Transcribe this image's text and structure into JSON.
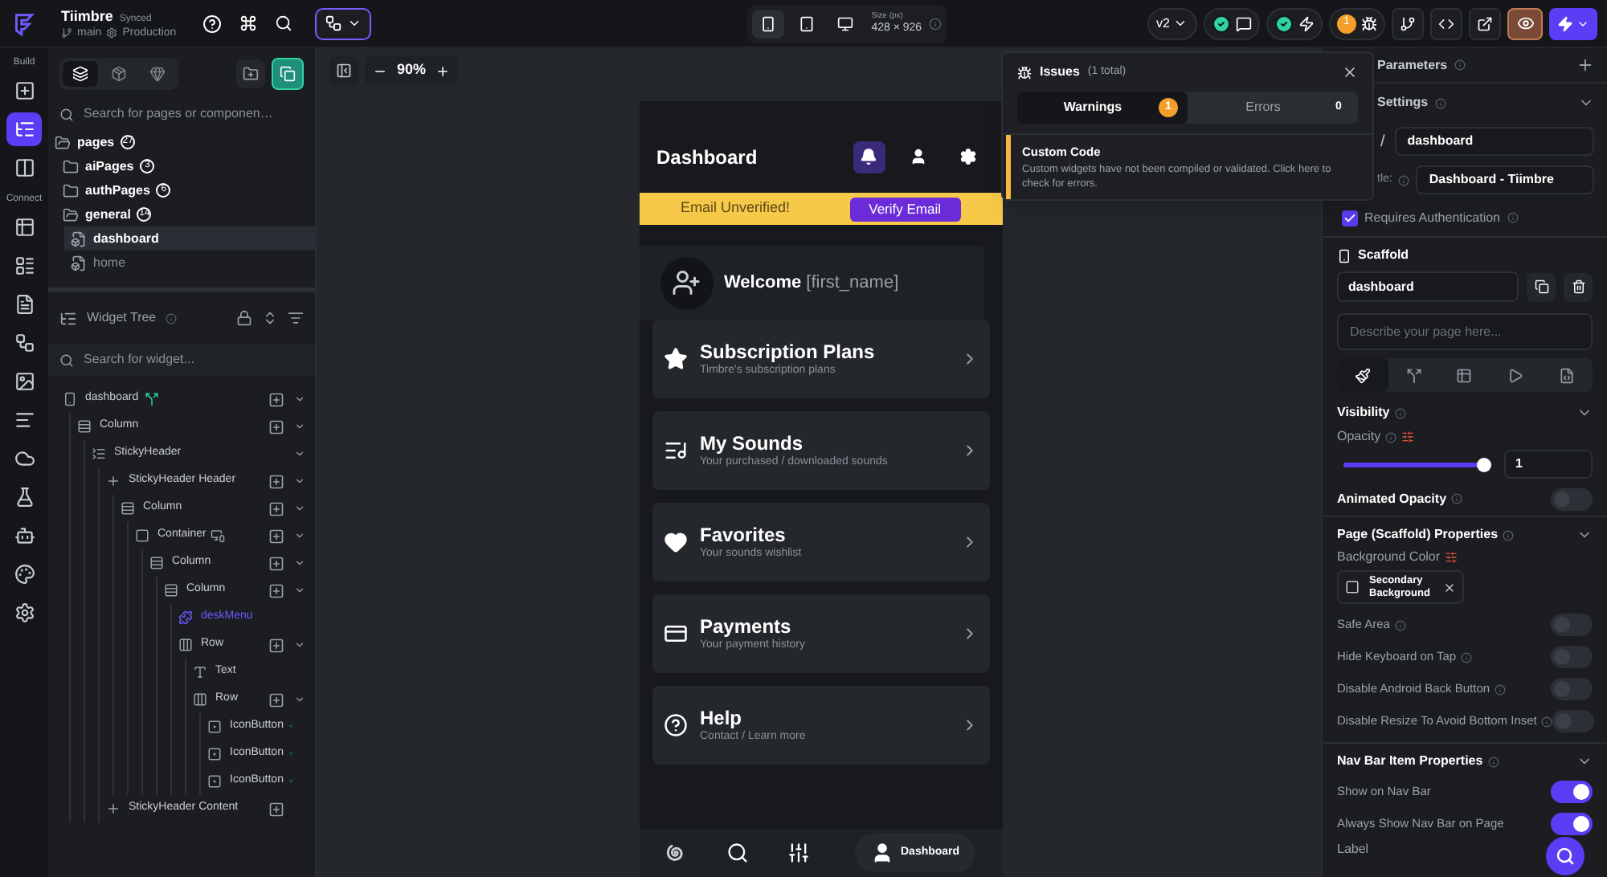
{
  "topbar": {
    "project": "Tiimbre",
    "sync_status": "Synced",
    "branch": "main",
    "environment": "Production",
    "devices": [
      {
        "kind": "phone",
        "selected": true
      },
      {
        "kind": "tablet",
        "selected": false
      },
      {
        "kind": "desktop",
        "selected": false
      }
    ],
    "size_label": "Size (px)",
    "size": "428 × 926",
    "version": "v2",
    "warning_count": "1"
  },
  "rail": [
    {
      "label": "Build",
      "items": [
        {
          "kind": "add-widget",
          "selected": false
        },
        {
          "kind": "tree",
          "selected": true
        },
        {
          "kind": "storyboard",
          "selected": false
        }
      ]
    },
    {
      "label": "Connect",
      "items": [
        {
          "kind": "database",
          "selected": false
        },
        {
          "kind": "schema",
          "selected": false
        },
        {
          "kind": "file",
          "selected": false
        },
        {
          "kind": "nodes",
          "selected": false
        },
        {
          "kind": "image",
          "selected": false
        },
        {
          "kind": "list",
          "selected": false
        },
        {
          "kind": "cloud",
          "selected": false
        },
        {
          "kind": "test",
          "selected": false
        },
        {
          "kind": "robot",
          "selected": false
        },
        {
          "kind": "theme",
          "selected": false
        },
        {
          "kind": "settings",
          "selected": false
        }
      ]
    }
  ],
  "pages_panel": {
    "tabs": [
      {
        "kind": "pages",
        "selected": true
      },
      {
        "kind": "components",
        "selected": false
      },
      {
        "kind": "library",
        "selected": false
      }
    ],
    "search_placeholder": "Search for pages or componen…",
    "tree": [
      {
        "kind": "folder",
        "name": "pages",
        "count": "27",
        "expanded": true,
        "children": [
          {
            "kind": "folder",
            "name": "aiPages",
            "count": "3",
            "expanded": false
          },
          {
            "kind": "folder",
            "name": "authPages",
            "count": "6",
            "expanded": false
          },
          {
            "kind": "folder",
            "name": "general",
            "count": "14",
            "expanded": true,
            "children": [
              {
                "kind": "page",
                "name": "dashboard",
                "selected": true
              },
              {
                "kind": "page",
                "name": "home",
                "selected": false
              }
            ]
          }
        ]
      }
    ]
  },
  "widget_tree": {
    "title": "Widget Tree",
    "search_placeholder": "Search for widget...",
    "nodes": [
      {
        "kind": "page",
        "name": "dashboard",
        "has_action": true,
        "can_add": true,
        "children": [
          {
            "kind": "column",
            "name": "Column",
            "can_add": true,
            "children": [
              {
                "kind": "sticky",
                "name": "StickyHeader",
                "can_add": false,
                "children": [
                  {
                    "kind": "plus",
                    "name": "StickyHeader Header",
                    "can_add": true,
                    "children": [
                      {
                        "kind": "column",
                        "name": "Column",
                        "can_add": true,
                        "children": [
                          {
                            "kind": "container",
                            "name": "Container",
                            "responsive": true,
                            "can_add": true,
                            "children": [
                              {
                                "kind": "column",
                                "name": "Column",
                                "can_add": true,
                                "children": [
                                  {
                                    "kind": "column",
                                    "name": "Column",
                                    "can_add": true,
                                    "children": [
                                      {
                                        "kind": "custom",
                                        "name": "deskMenu",
                                        "can_add": false
                                      },
                                      {
                                        "kind": "row",
                                        "name": "Row",
                                        "can_add": true,
                                        "children": [
                                          {
                                            "kind": "text",
                                            "name": "Text",
                                            "can_add": false
                                          },
                                          {
                                            "kind": "row",
                                            "name": "Row",
                                            "can_add": true,
                                            "children": [
                                              {
                                                "kind": "iconbutton",
                                                "name": "IconButton",
                                                "has_action": true,
                                                "can_add": false
                                              },
                                              {
                                                "kind": "iconbutton",
                                                "name": "IconButton",
                                                "has_action": true,
                                                "can_add": false
                                              },
                                              {
                                                "kind": "iconbutton",
                                                "name": "IconButton",
                                                "has_action": true,
                                                "can_add": false
                                              }
                                            ]
                                          }
                                        ]
                                      }
                                    ]
                                  }
                                ]
                              }
                            ]
                          }
                        ]
                      }
                    ]
                  },
                  {
                    "kind": "plus",
                    "name": "StickyHeader Content",
                    "can_add": true
                  }
                ]
              }
            ]
          }
        ]
      }
    ]
  },
  "canvas": {
    "zoom": "90%"
  },
  "phone": {
    "title": "Dashboard",
    "header_icons": [
      {
        "kind": "bell",
        "selected": true
      },
      {
        "kind": "person",
        "selected": false
      },
      {
        "kind": "settings",
        "selected": false
      }
    ],
    "banner": {
      "text": "Email Unverified!",
      "button": "Verify Email"
    },
    "welcome": {
      "text": "Welcome",
      "name": "[first_name]"
    },
    "cards": [
      {
        "kind": "star",
        "title": "Subscription Plans",
        "subtitle": "Timbre's subscription plans"
      },
      {
        "kind": "music",
        "title": "My Sounds",
        "subtitle": "Your purchased / downloaded sounds"
      },
      {
        "kind": "heart",
        "title": "Favorites",
        "subtitle": "Your sounds wishlist"
      },
      {
        "kind": "card",
        "title": "Payments",
        "subtitle": "Your payment history"
      },
      {
        "kind": "help",
        "title": "Help",
        "subtitle": "Contact / Learn more"
      }
    ],
    "nav": [
      {
        "kind": "spiral",
        "selected": false
      },
      {
        "kind": "search",
        "selected": false
      },
      {
        "kind": "tune",
        "selected": false
      },
      {
        "kind": "person",
        "label": "Dashboard",
        "selected": true
      }
    ]
  },
  "issues": {
    "title": "Issues",
    "total": "(1 total)",
    "tabs": [
      {
        "label": "Warnings",
        "count": "1",
        "selected": true
      },
      {
        "label": "Errors",
        "count": "0",
        "selected": false
      }
    ],
    "items": [
      {
        "title": "Custom Code",
        "description": "Custom widgets have not been compiled or validated. Click here to check for errors."
      }
    ]
  },
  "properties": {
    "parameters_title": "Parameters",
    "settings_title": "Settings",
    "route_separator": "/",
    "route": "dashboard",
    "title_label": "tle:",
    "title_value": "Dashboard - Tiimbre",
    "requires_auth": {
      "label": "Requires Authentication",
      "checked": true
    },
    "scaffold": {
      "title": "Scaffold",
      "name": "dashboard",
      "description_placeholder": "Describe your page here...",
      "tabs": [
        {
          "kind": "style",
          "selected": true
        },
        {
          "kind": "actions",
          "selected": false
        },
        {
          "kind": "layout",
          "selected": false
        },
        {
          "kind": "play",
          "selected": false
        },
        {
          "kind": "doc",
          "selected": false
        }
      ]
    },
    "visibility_title": "Visibility",
    "opacity": {
      "label": "Opacity",
      "level": 1,
      "value": "1"
    },
    "animated_opacity": {
      "label": "Animated Opacity",
      "on": false
    },
    "page_properties": {
      "title": "Page (Scaffold) Properties",
      "background_label": "Background Color",
      "background_value": "Secondary Background",
      "toggles": [
        {
          "label": "Safe Area",
          "on": false
        },
        {
          "label": "Hide Keyboard on Tap",
          "on": false
        },
        {
          "label": "Disable Android Back Button",
          "on": false
        },
        {
          "label": "Disable Resize To Avoid Bottom Inset",
          "on": false
        }
      ]
    },
    "nav_bar": {
      "title": "Nav Bar Item Properties",
      "toggles": [
        {
          "label": "Show on Nav Bar",
          "on": true
        },
        {
          "label": "Always Show Nav Bar on Page",
          "on": true
        }
      ],
      "label_title": "Label"
    }
  }
}
